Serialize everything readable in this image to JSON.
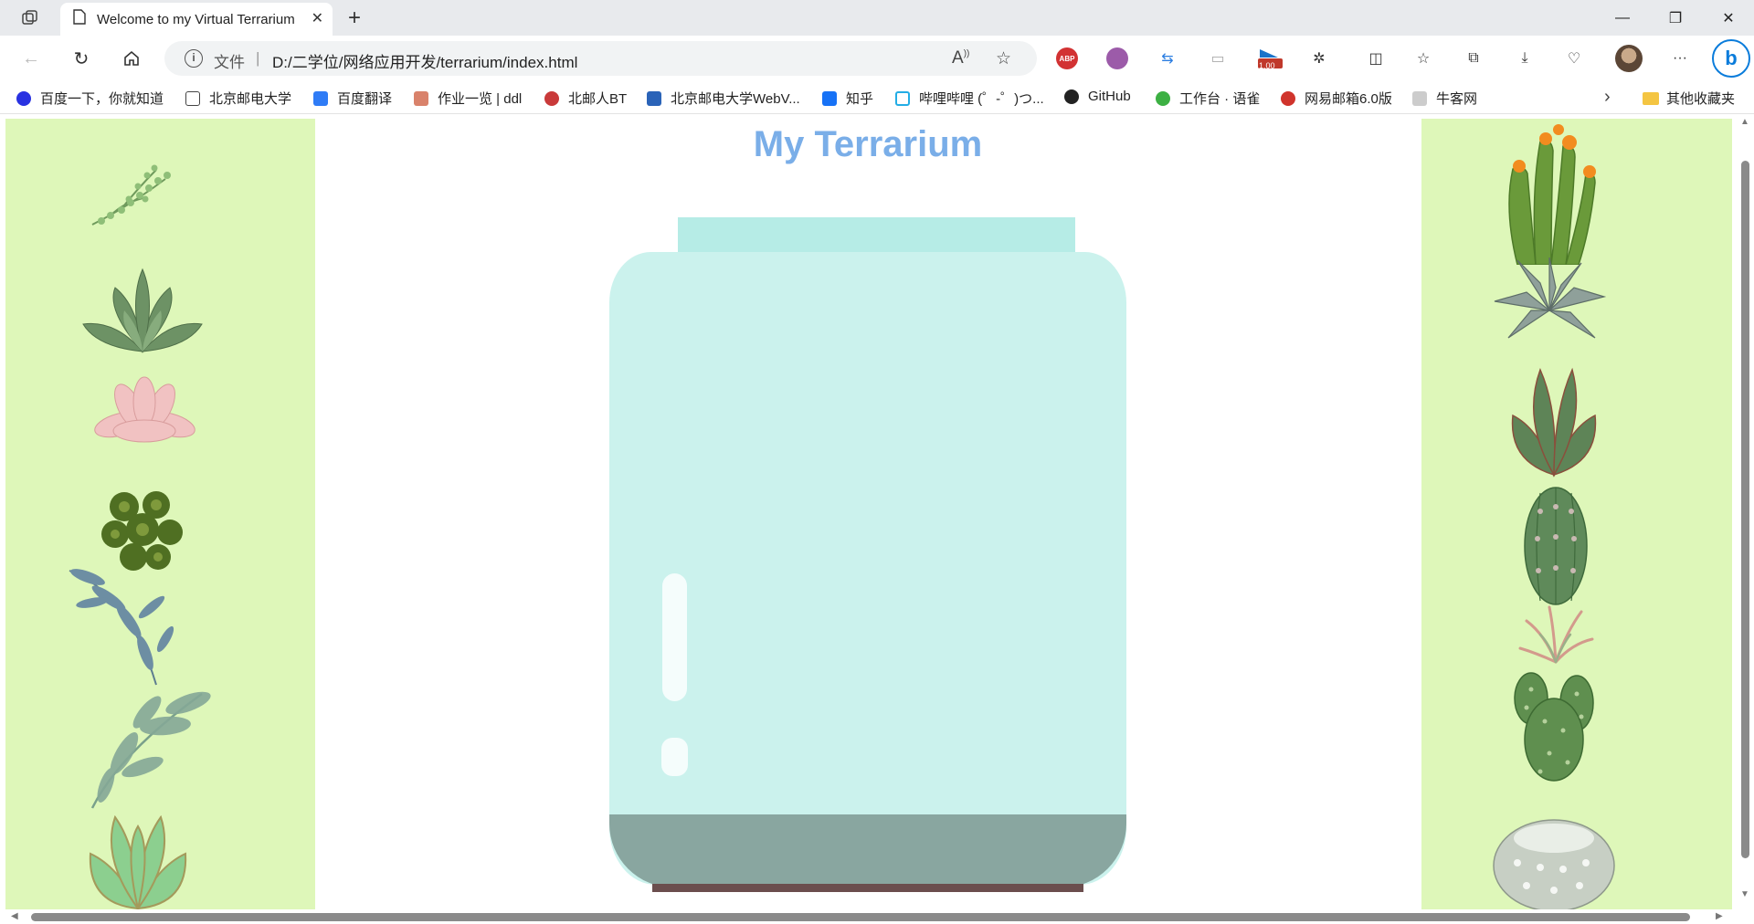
{
  "browser": {
    "tab_title": "Welcome to my Virtual Terrarium",
    "new_tab": "+",
    "address_file_label": "文件",
    "address_separator": "|",
    "address_url": "D:/二学位/网络应用开发/terrarium/index.html",
    "ext_badge": "1.00",
    "bookmarks": [
      {
        "label": "百度一下，你就知道",
        "icon_color": "#2932e1"
      },
      {
        "label": "北京邮电大学",
        "icon_color": "#ffffff"
      },
      {
        "label": "百度翻译",
        "icon_color": "#2f7cf6"
      },
      {
        "label": "作业一览 | ddl",
        "icon_color": "#d9826b"
      },
      {
        "label": "北邮人BT",
        "icon_color": "#c93a3a"
      },
      {
        "label": "北京邮电大学WebV...",
        "icon_color": "#2a63b8"
      },
      {
        "label": "知乎",
        "icon_color": "#1772f6"
      },
      {
        "label": "哔哩哔哩 (゜-゜)つ...",
        "icon_color": "#23ade5"
      },
      {
        "label": "GitHub",
        "icon_color": "#222222"
      },
      {
        "label": "工作台 · 语雀",
        "icon_color": "#3cb043"
      },
      {
        "label": "网易邮箱6.0版",
        "icon_color": "#d0342c"
      },
      {
        "label": "牛客网",
        "icon_color": "#cccccc"
      }
    ],
    "other_bookmarks": "其他收藏夹"
  },
  "page": {
    "title": "My Terrarium",
    "left_plants": [
      "plant1",
      "plant2",
      "plant3",
      "plant4",
      "plant5",
      "plant6",
      "plant7"
    ],
    "right_plants": [
      "plant8",
      "plant9",
      "plant10",
      "plant11",
      "plant12",
      "plant13",
      "plant14"
    ]
  },
  "colors": {
    "container_bg": "#def7b9",
    "title": "#7aaee8",
    "jar_walls": "#cbf2ed",
    "jar_top": "#b6ece6",
    "dirt": "#89a6a0",
    "jar_bottom": "#6b4e4e"
  }
}
